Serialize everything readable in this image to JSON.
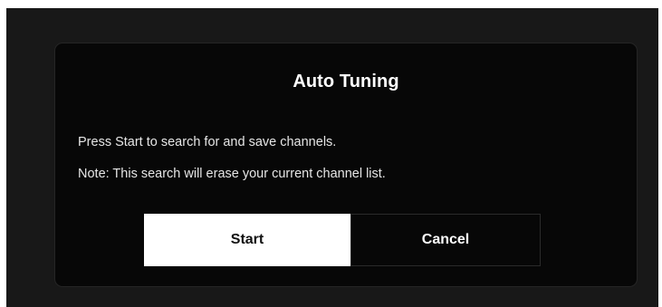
{
  "dialog": {
    "title": "Auto Tuning",
    "message_line1": "Press Start to search for and save channels.",
    "message_line2": "Note: This search will erase your current channel list.",
    "buttons": {
      "start_label": "Start",
      "cancel_label": "Cancel"
    },
    "focused_button": "Start"
  },
  "colors": {
    "screen_background": "#181818",
    "dialog_background": "#070707",
    "focused_button_background": "#ffffff",
    "text": "#ffffff"
  }
}
